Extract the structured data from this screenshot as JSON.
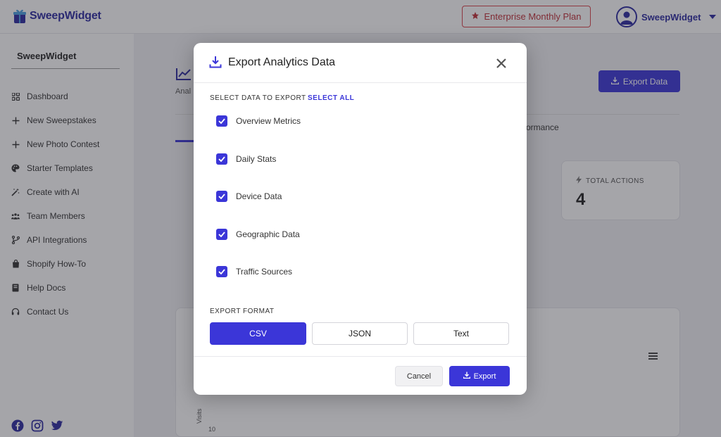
{
  "header": {
    "logo_text": "SweepWidget",
    "plan_label": "Enterprise Monthly Plan",
    "user_name": "SweepWidget",
    "brand_color": "#2b2aa0",
    "accent_color": "#3b36d8"
  },
  "sidebar": {
    "title": "SweepWidget",
    "items": [
      {
        "label": "Dashboard",
        "icon": "grid-icon"
      },
      {
        "label": "New Sweepstakes",
        "icon": "plus-icon"
      },
      {
        "label": "New Photo Contest",
        "icon": "plus-icon"
      },
      {
        "label": "Starter Templates",
        "icon": "palette-icon"
      },
      {
        "label": "Create with AI",
        "icon": "magic-wand-icon"
      },
      {
        "label": "Team Members",
        "icon": "users-icon"
      },
      {
        "label": "API Integrations",
        "icon": "branch-icon"
      },
      {
        "label": "Shopify How-To",
        "icon": "shopping-bag-icon"
      },
      {
        "label": "Help Docs",
        "icon": "book-icon"
      },
      {
        "label": "Contact Us",
        "icon": "headset-icon"
      }
    ],
    "social": [
      "facebook-icon",
      "instagram-icon",
      "twitter-icon"
    ]
  },
  "main": {
    "title_partial": "Anal",
    "export_data_label": "Export Data",
    "tab_performance": "erformance",
    "total_actions_label": "TOTAL ACTIONS",
    "total_actions_value": "4",
    "chart_y_label": "Visits",
    "chart_y_tick": "10"
  },
  "modal": {
    "title": "Export Analytics Data",
    "select_label": "SELECT DATA TO EXPORT",
    "select_all": "SELECT ALL",
    "options": [
      {
        "label": "Overview Metrics",
        "checked": true
      },
      {
        "label": "Daily Stats",
        "checked": true
      },
      {
        "label": "Device Data",
        "checked": true
      },
      {
        "label": "Geographic Data",
        "checked": true
      },
      {
        "label": "Traffic Sources",
        "checked": true
      }
    ],
    "format_label": "EXPORT FORMAT",
    "formats": [
      "CSV",
      "JSON",
      "Text"
    ],
    "selected_format": "CSV",
    "cancel_label": "Cancel",
    "export_label": "Export"
  }
}
